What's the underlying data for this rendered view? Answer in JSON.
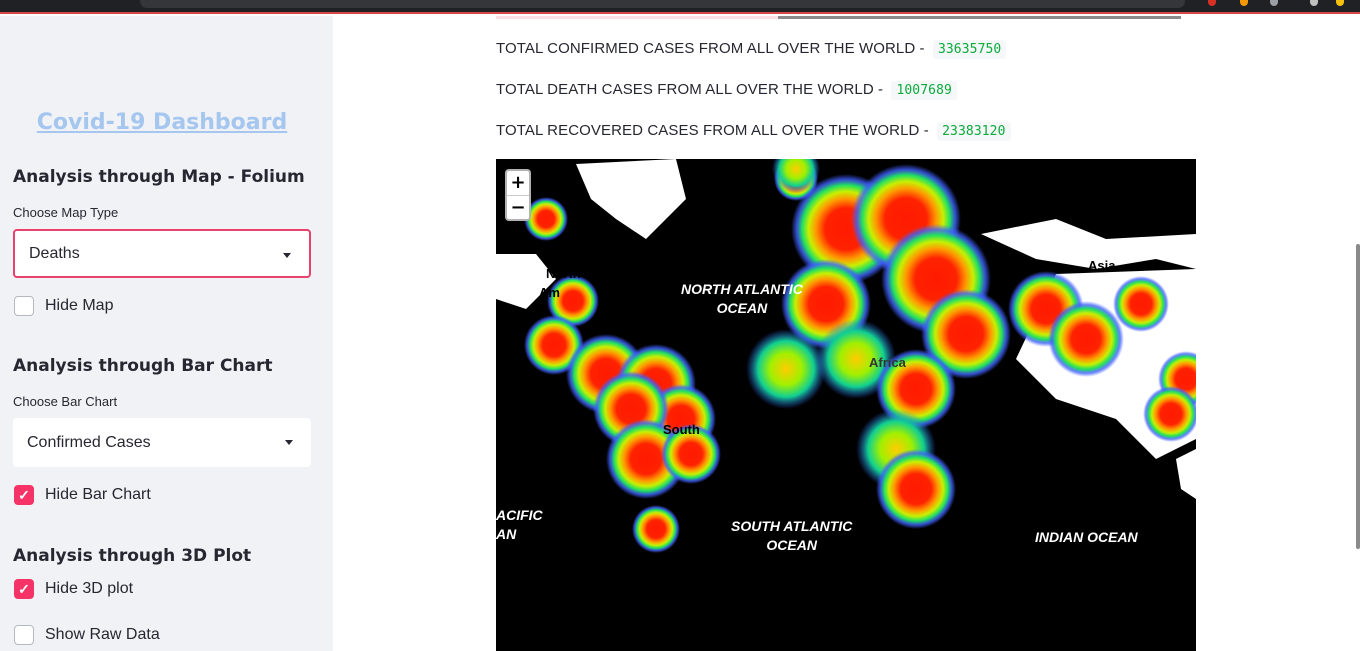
{
  "sidebar": {
    "title": "Covid-19 Dashboard",
    "map_section": {
      "heading": "Analysis through Map - Folium",
      "select_label": "Choose Map Type",
      "select_value": "Deaths",
      "hide_label": "Hide Map",
      "hide_checked": false
    },
    "bar_section": {
      "heading": "Analysis through Bar Chart",
      "select_label": "Choose Bar Chart",
      "select_value": "Confirmed Cases",
      "hide_label": "Hide Bar Chart",
      "hide_checked": true
    },
    "plot_section": {
      "heading": "Analysis through 3D Plot",
      "hide_label": "Hide 3D plot",
      "hide_checked": true,
      "raw_label": "Show Raw Data",
      "raw_checked": false
    }
  },
  "main": {
    "stats": [
      {
        "label": "TOTAL CONFIRMED CASES FROM ALL OVER THE WORLD -",
        "value": "33635750"
      },
      {
        "label": "TOTAL DEATH CASES FROM ALL OVER THE WORLD -",
        "value": "1007689"
      },
      {
        "label": "TOTAL RECOVERED CASES FROM ALL OVER THE WORLD -",
        "value": "23383120"
      }
    ],
    "map": {
      "zoom_in": "+",
      "zoom_out": "−",
      "labels": {
        "north_america_1": "North",
        "north_america_2": "Am",
        "north_atlantic_1": "NORTH ATLANTIC",
        "north_atlantic_2": "OCEAN",
        "africa": "Africa",
        "south_america": "South",
        "asia": "Asia",
        "pacific_1": "ACIFIC",
        "pacific_2": "AN",
        "south_atlantic_1": "SOUTH ATLANTIC",
        "south_atlantic_2": "OCEAN",
        "indian_ocean": "INDIAN OCEAN"
      }
    }
  },
  "colors": {
    "accent": "#f63366",
    "title_link": "#a4c6ef",
    "stat_value": "#09ab3b",
    "sidebar_bg": "#f0f2f6"
  }
}
